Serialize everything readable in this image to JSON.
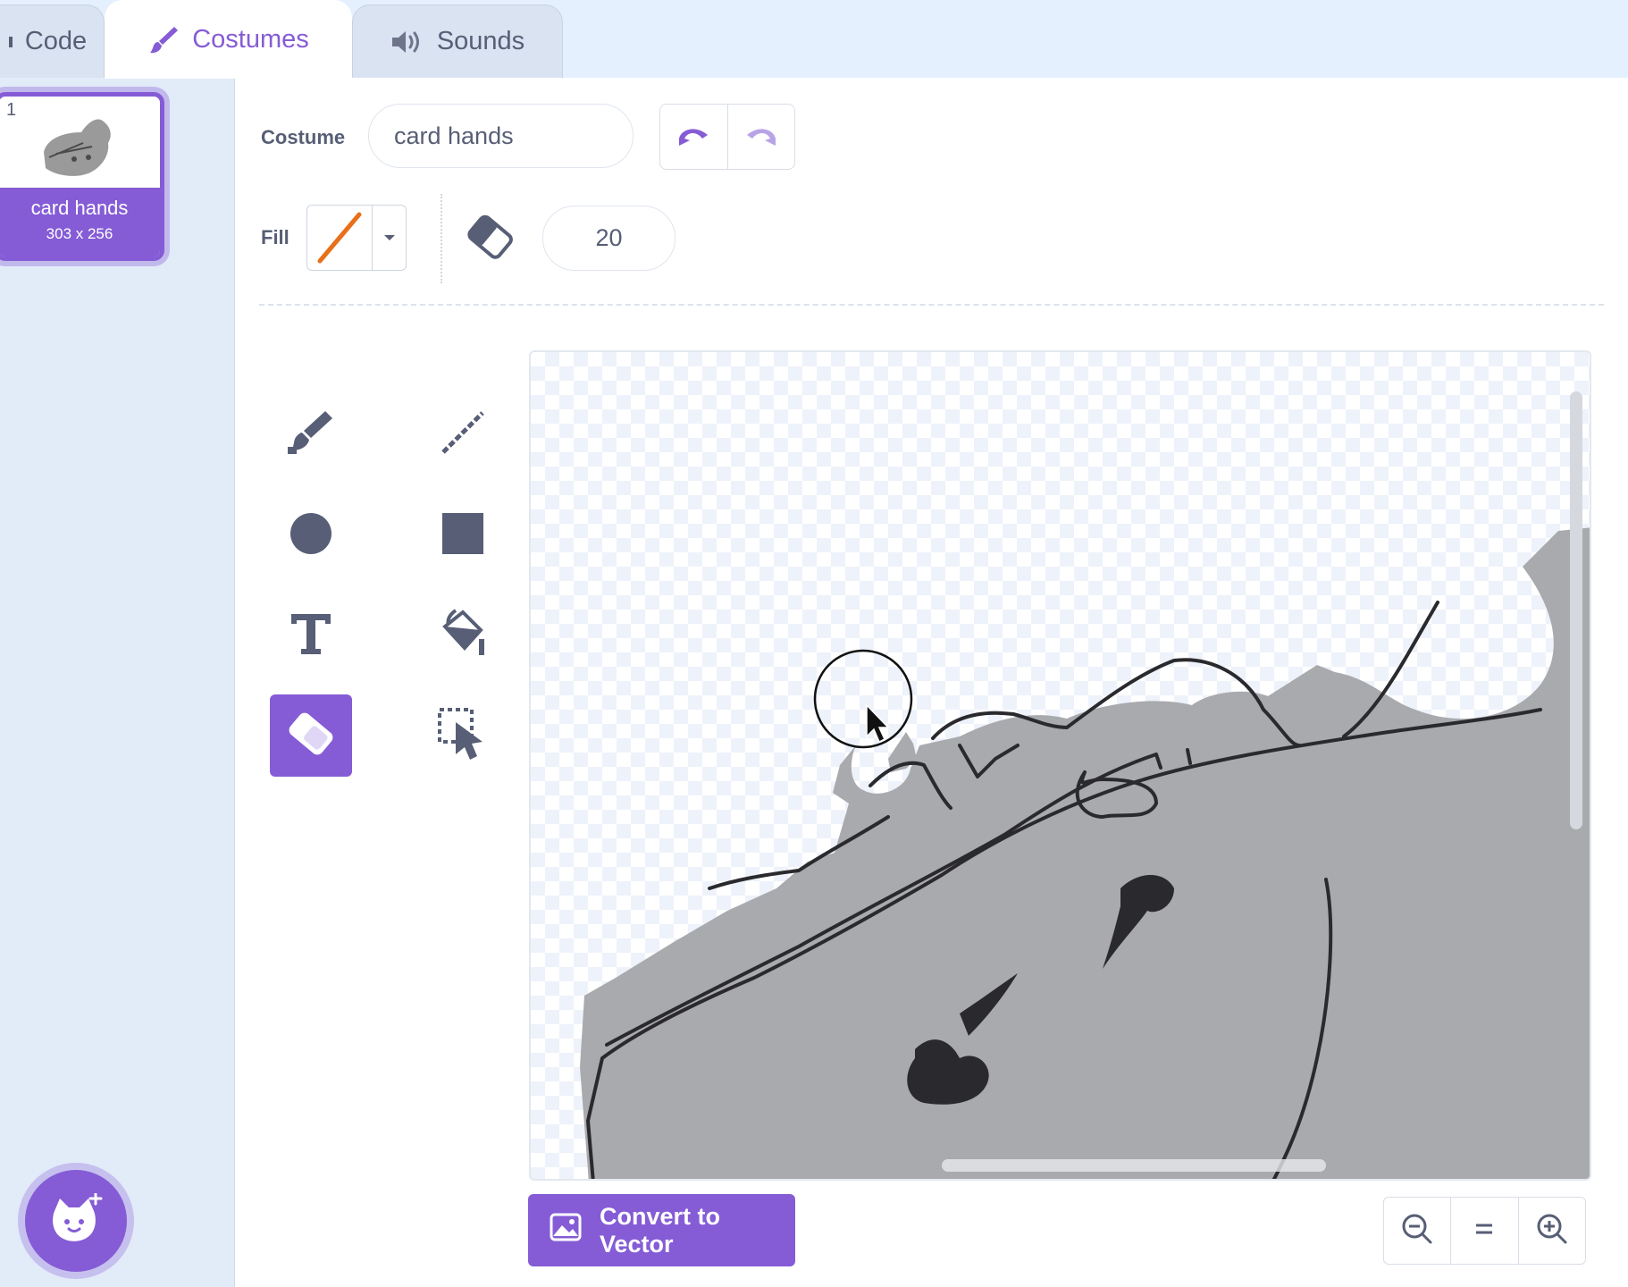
{
  "tabs": [
    {
      "label": "Code",
      "icon": "code-icon",
      "active": false
    },
    {
      "label": "Costumes",
      "icon": "paintbrush-icon",
      "active": true
    },
    {
      "label": "Sounds",
      "icon": "speaker-icon",
      "active": false
    }
  ],
  "costume_list": {
    "items": [
      {
        "number": "1",
        "name": "card hands",
        "size": "303 x 256",
        "selected": true
      }
    ],
    "add_button_icon": "add-sprite-cat-icon"
  },
  "editor": {
    "costume_label": "Costume",
    "costume_name": "card hands",
    "fill_label": "Fill",
    "brush_size": "20",
    "active_tool": "eraser",
    "tools": [
      "brush",
      "line",
      "circle",
      "rectangle",
      "text",
      "fill",
      "eraser",
      "select"
    ],
    "convert_button": "Convert to Vector",
    "zoom_buttons": [
      "zoom-out",
      "zoom-reset",
      "zoom-in"
    ]
  },
  "colors": {
    "accent": "#855cd6",
    "text": "#575e75",
    "fill_swatch_stroke": "#e8701a",
    "tab_bar": "#e5f0ff"
  }
}
